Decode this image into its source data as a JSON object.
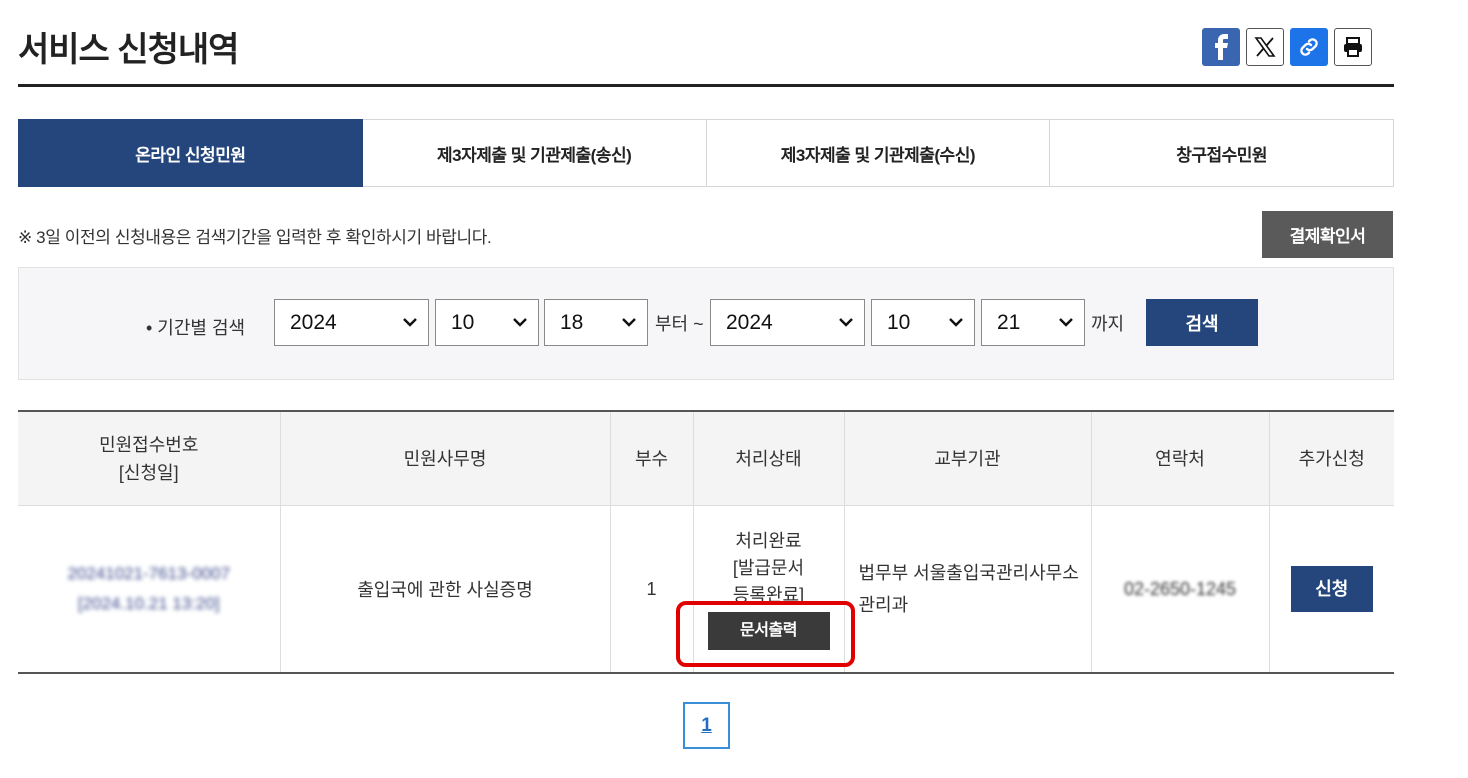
{
  "header": {
    "title": "서비스 신청내역",
    "share": [
      {
        "name": "facebook-icon",
        "glyph": "f"
      },
      {
        "name": "x-twitter-icon",
        "glyph": "𝕏"
      },
      {
        "name": "link-icon",
        "glyph": "🔗"
      },
      {
        "name": "print-icon",
        "glyph": "🖨"
      }
    ]
  },
  "tabs": [
    {
      "label": "온라인 신청민원",
      "active": true
    },
    {
      "label": "제3자제출 및 기관제출(송신)",
      "active": false
    },
    {
      "label": "제3자제출 및 기관제출(수신)",
      "active": false
    },
    {
      "label": "창구접수민원",
      "active": false
    }
  ],
  "notice": "※ 3일 이전의 신청내용은 검색기간을 입력한 후 확인하시기 바랍니다.",
  "confirm_button": "결제확인서",
  "search": {
    "label": "• 기간별 검색",
    "from": {
      "year": "2024",
      "month": "10",
      "day": "18"
    },
    "from_suffix": "부터 ~",
    "to": {
      "year": "2024",
      "month": "10",
      "day": "21"
    },
    "to_suffix": "까지",
    "button": "검색"
  },
  "table": {
    "headers": {
      "receipt_no": "민원접수번호",
      "receipt_date": "[신청일]",
      "service": "민원사무명",
      "copies": "부수",
      "status": "처리상태",
      "agency": "교부기관",
      "contact": "연락처",
      "extra": "추가신청"
    },
    "rows": [
      {
        "receipt_no": "20241021-7613-0007",
        "receipt_date": "[2024.10.21 13:20]",
        "service": "출입국에 관한 사실증명",
        "copies": "1",
        "status_lines": [
          "처리완료",
          "[발급문서",
          "등록완료]"
        ],
        "print_button": "문서출력",
        "agency": "법무부 서울출입국관리사무소 관리과",
        "contact": "02-2650-1245",
        "apply_button": "신청"
      }
    ]
  },
  "pagination": {
    "current": "1"
  },
  "colors": {
    "primary": "#24467c",
    "highlight": "#e10000",
    "dark_button": "#3a3a3a"
  }
}
